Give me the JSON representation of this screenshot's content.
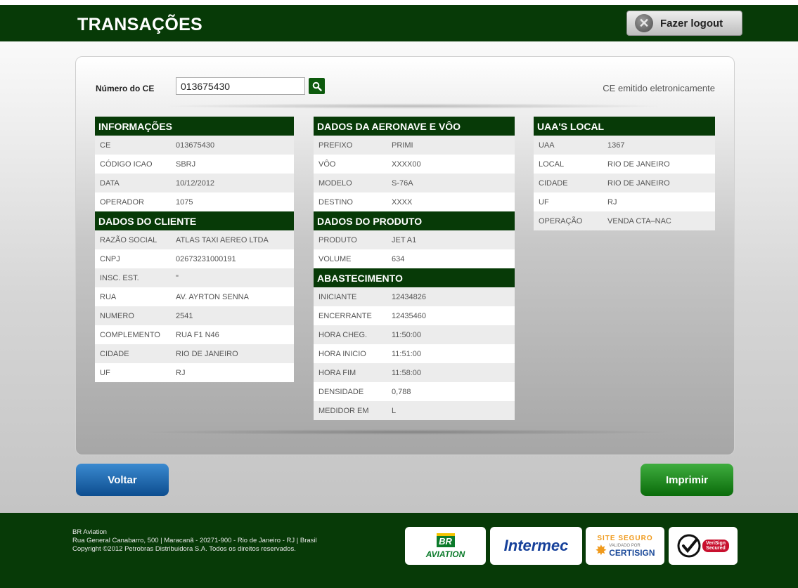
{
  "header": {
    "title": "TRANSAÇÕES",
    "logout_label": "Fazer logout"
  },
  "search": {
    "label": "Número do CE",
    "value": "013675430",
    "status": "CE emitido eletronicamente"
  },
  "informacoes": {
    "title": "INFORMAÇÕES",
    "rows": [
      {
        "label": "CE",
        "value": "013675430"
      },
      {
        "label": "CÓDIGO ICAO",
        "value": "SBRJ"
      },
      {
        "label": "DATA",
        "value": "10/12/2012"
      },
      {
        "label": "OPERADOR",
        "value": "1075"
      }
    ]
  },
  "cliente": {
    "title": "DADOS DO CLIENTE",
    "rows": [
      {
        "label": "RAZÃO SOCIAL",
        "value": "ATLAS TAXI AEREO LTDA"
      },
      {
        "label": "CNPJ",
        "value": "02673231000191"
      },
      {
        "label": "INSC. EST.",
        "value": "\""
      },
      {
        "label": "RUA",
        "value": "AV. AYRTON SENNA"
      },
      {
        "label": "NUMERO",
        "value": "2541"
      },
      {
        "label": "COMPLEMENTO",
        "value": "RUA F1 N46"
      },
      {
        "label": "CIDADE",
        "value": "RIO DE JANEIRO"
      },
      {
        "label": "UF",
        "value": "RJ"
      }
    ]
  },
  "aeronave": {
    "title": "DADOS DA AERONAVE E VÔO",
    "rows": [
      {
        "label": "PREFIXO",
        "value": "PRIMI"
      },
      {
        "label": "VÔO",
        "value": "XXXX00"
      },
      {
        "label": "MODELO",
        "value": "S-76A"
      },
      {
        "label": "DESTINO",
        "value": "XXXX"
      }
    ]
  },
  "produto": {
    "title": "DADOS DO PRODUTO",
    "rows": [
      {
        "label": "PRODUTO",
        "value": "JET A1"
      },
      {
        "label": "VOLUME",
        "value": "634"
      }
    ]
  },
  "abastecimento": {
    "title": "ABASTECIMENTO",
    "rows": [
      {
        "label": "INICIANTE",
        "value": "12434826"
      },
      {
        "label": "ENCERRANTE",
        "value": "12435460"
      },
      {
        "label": "HORA CHEG.",
        "value": "11:50:00"
      },
      {
        "label": "HORA INICIO",
        "value": "11:51:00"
      },
      {
        "label": "HORA FIM",
        "value": "11:58:00"
      },
      {
        "label": "DENSIDADE",
        "value": "0,788"
      },
      {
        "label": "MEDIDOR EM",
        "value": "L"
      }
    ]
  },
  "uaa": {
    "title": "UAA'S LOCAL",
    "rows": [
      {
        "label": "UAA",
        "value": "1367"
      },
      {
        "label": "LOCAL",
        "value": "RIO DE JANEIRO"
      },
      {
        "label": "CIDADE",
        "value": "RIO DE JANEIRO"
      },
      {
        "label": "UF",
        "value": "RJ"
      },
      {
        "label": "OPERAÇÃO",
        "value": "VENDA CTA–NAC"
      }
    ]
  },
  "buttons": {
    "back": "Voltar",
    "print": "Imprimir"
  },
  "footer": {
    "line1": "BR Aviation",
    "line2": "Rua General Canabarro, 500 | Maracanã - 20271-900 - Rio de Janeiro - RJ | Brasil",
    "line3": "Copyright ©2012 Petrobras Distribuidora S.A. Todos os direitos reservados.",
    "logos": {
      "br": "BR",
      "aviation": "AVIATION",
      "intermec": "Intermec",
      "site_seguro": "SITE SEGURO",
      "validado": "VALIDADO POR",
      "certisign": "CERTISIGN",
      "verisign1": "VeriSign",
      "verisign2": "Secured"
    }
  },
  "colors": {
    "brand_green": "#073a07",
    "back_blue": "#0d4d8f",
    "print_green": "#0a6b0a"
  }
}
